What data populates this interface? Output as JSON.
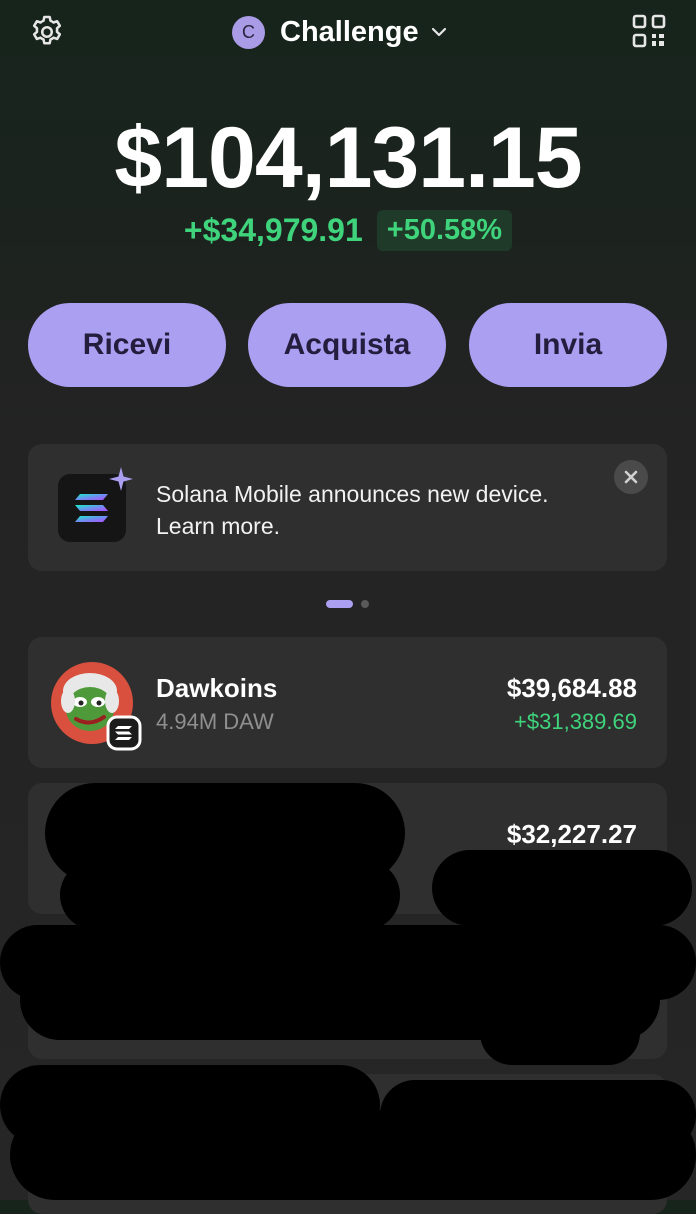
{
  "header": {
    "account_initial": "C",
    "account_name": "Challenge"
  },
  "portfolio": {
    "balance": "$104,131.15",
    "change_abs": "+$34,979.91",
    "change_pct": "+50.58%"
  },
  "actions": {
    "receive": "Ricevi",
    "buy": "Acquista",
    "send": "Invia"
  },
  "banner": {
    "text": "Solana Mobile announces new device. Learn more."
  },
  "tokens": [
    {
      "name": "Dawkoins",
      "quantity": "4.94M DAW",
      "value": "$39,684.88",
      "pnl": "+$31,389.69"
    },
    {
      "value": "$32,227.27"
    }
  ],
  "colors": {
    "accent": "#ab9ff2",
    "positive": "#3fd37c",
    "card": "#2f2f2f"
  }
}
